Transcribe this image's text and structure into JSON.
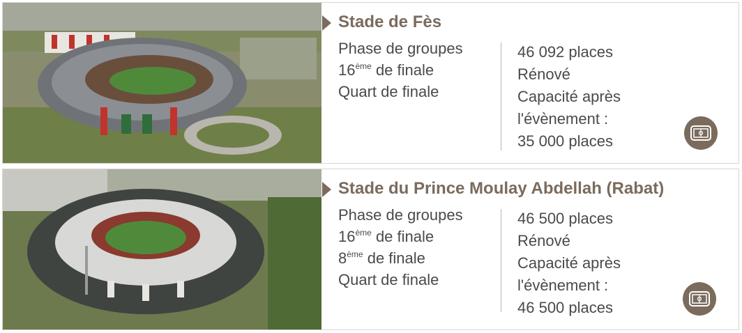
{
  "stadiums": [
    {
      "name": "Stade de Fès",
      "phases": [
        {
          "main": "Phase de groupes",
          "sup": "",
          "rest": ""
        },
        {
          "main": "16",
          "sup": "ème",
          "rest": " de finale"
        },
        {
          "main": "Quart de finale",
          "sup": "",
          "rest": ""
        }
      ],
      "details": [
        "46 092 places",
        "Rénové",
        "Capacité après",
        "l'évènement :",
        "35 000 places"
      ],
      "photo_alt": "Aerial view of Stade de Fès"
    },
    {
      "name": "Stade du Prince Moulay Abdellah (Rabat)",
      "phases": [
        {
          "main": "Phase de groupes",
          "sup": "",
          "rest": ""
        },
        {
          "main": "16",
          "sup": "ème",
          "rest": " de finale"
        },
        {
          "main": "8",
          "sup": "ème",
          "rest": " de finale"
        },
        {
          "main": "Quart de finale",
          "sup": "",
          "rest": ""
        }
      ],
      "details": [
        "46 500 places",
        "Rénové",
        "Capacité après",
        "l'évènement :",
        "46 500 places"
      ],
      "photo_alt": "Aerial view of Stade du Prince Moulay Abdellah"
    }
  ],
  "colors": {
    "accent": "#7a6b5d",
    "text": "#4a4a4a",
    "border": "#d9d5d0",
    "pitch": "#4f8a3a"
  },
  "icon": "stadium-icon"
}
